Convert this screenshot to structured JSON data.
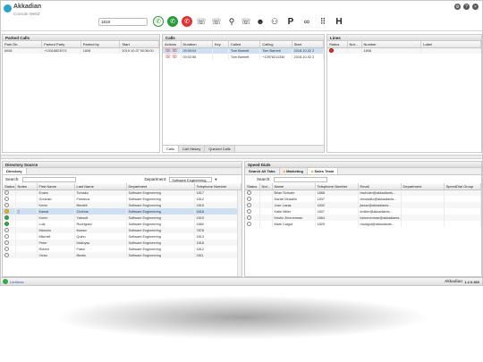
{
  "app": {
    "brand": "Akkadian",
    "sub": "Console WebZ",
    "version": "1.2.0.360"
  },
  "dial": {
    "value": "1818"
  },
  "toolbar_icons": [
    "call-icon",
    "answer-icon",
    "hangup-icon",
    "transfer-icon",
    "consult-transfer-icon",
    "conference-icon",
    "hold-icon",
    "contacts-icon",
    "park-icon",
    "voicemail-icon",
    "keypad-icon",
    "hold-h-icon"
  ],
  "parked": {
    "title": "Parked Calls",
    "headers": [
      "Park Dir.",
      "Parked Party",
      "Parked by",
      "Start"
    ],
    "rows": [
      [
        "6008",
        "+13018823974",
        "1808",
        "2019-10-07 00:36:00"
      ]
    ]
  },
  "calls": {
    "title": "Calls",
    "headers": [
      "Actions",
      "Duration",
      "Key",
      "Called",
      "Calling",
      "Start"
    ],
    "rows": [
      [
        "",
        "00:00:04",
        "",
        "Tom Barnett",
        "Tom Barnett",
        "2018-10-02 2"
      ],
      [
        "",
        "00:02:56",
        "",
        "Tom Barnett",
        "+13978211340",
        "2018-10-02 2"
      ]
    ],
    "tabs": [
      "Calls",
      "Call History",
      "Queued Calls"
    ]
  },
  "lines": {
    "title": "Lines",
    "headers": [
      "Status",
      "Not...",
      "Number",
      "Label"
    ],
    "rows": [
      [
        "",
        "",
        "1808",
        ""
      ]
    ]
  },
  "directory": {
    "title": "Directory Source",
    "tab": "Directory",
    "search_label": "Search:",
    "dept_label": "Department:",
    "dept_value": "Software Engineering",
    "headers": [
      "Status",
      "Notes",
      "First Name",
      "Last Name",
      "Department",
      "Telephone Number"
    ],
    "rows": [
      [
        "Evans",
        "Tomako",
        "Software Engineering",
        "1817"
      ],
      [
        "Gonzalo",
        "Fonseca",
        "Software Engineering",
        "1812"
      ],
      [
        "Kevin",
        "Berdeit",
        "Software Engineering",
        "1815"
      ],
      [
        "Kamal",
        "Chohne",
        "Software Engineering",
        "1818"
      ],
      [
        "Kohm",
        "Yaboutt",
        "Software Engineering",
        "1819"
      ],
      [
        "Luis",
        "Rodriguez",
        "Software Engineering",
        "1860"
      ],
      [
        "Marcelo",
        "Ibanez",
        "Software Engineering",
        "7878"
      ],
      [
        "Mitchell",
        "Quinn",
        "Software Engineering",
        "1813"
      ],
      [
        "Peter",
        "Malloyss",
        "Software Engineering",
        "1816"
      ],
      [
        "Robert",
        "Franc",
        "Software Engineering",
        "1812"
      ],
      [
        "Victor",
        "Bestis",
        "Software Engineering",
        "1811"
      ]
    ]
  },
  "speed": {
    "title": "Speed Dials",
    "tabs": [
      "Search All Tabs",
      "Marketing",
      "Sales Team"
    ],
    "search_label": "Search:",
    "headers": [
      "Status",
      "Not...",
      "Name",
      "Telephone Number",
      "Email",
      "Department",
      "SpeedDial Group"
    ],
    "rows": [
      [
        "Brian Schuler",
        "1868",
        "bschuler@akkadiants..."
      ],
      [
        "Daniel Mussillo",
        "1837",
        "dmussillo@akkadiants..."
      ],
      [
        "Jose Lazaz",
        "1832",
        "jlazaz@akkadiants..."
      ],
      [
        "Katie Miller",
        "1807",
        "kmiller@akkadiants..."
      ],
      [
        "Kristin Zimmerman",
        "1864",
        "kzimmerman@akkadiants..."
      ],
      [
        "Mark Calgut",
        "1825",
        "mcalgut@akkadiants..."
      ]
    ]
  },
  "status_bar": {
    "label": "Limitless",
    "brand": "Akkadian"
  }
}
